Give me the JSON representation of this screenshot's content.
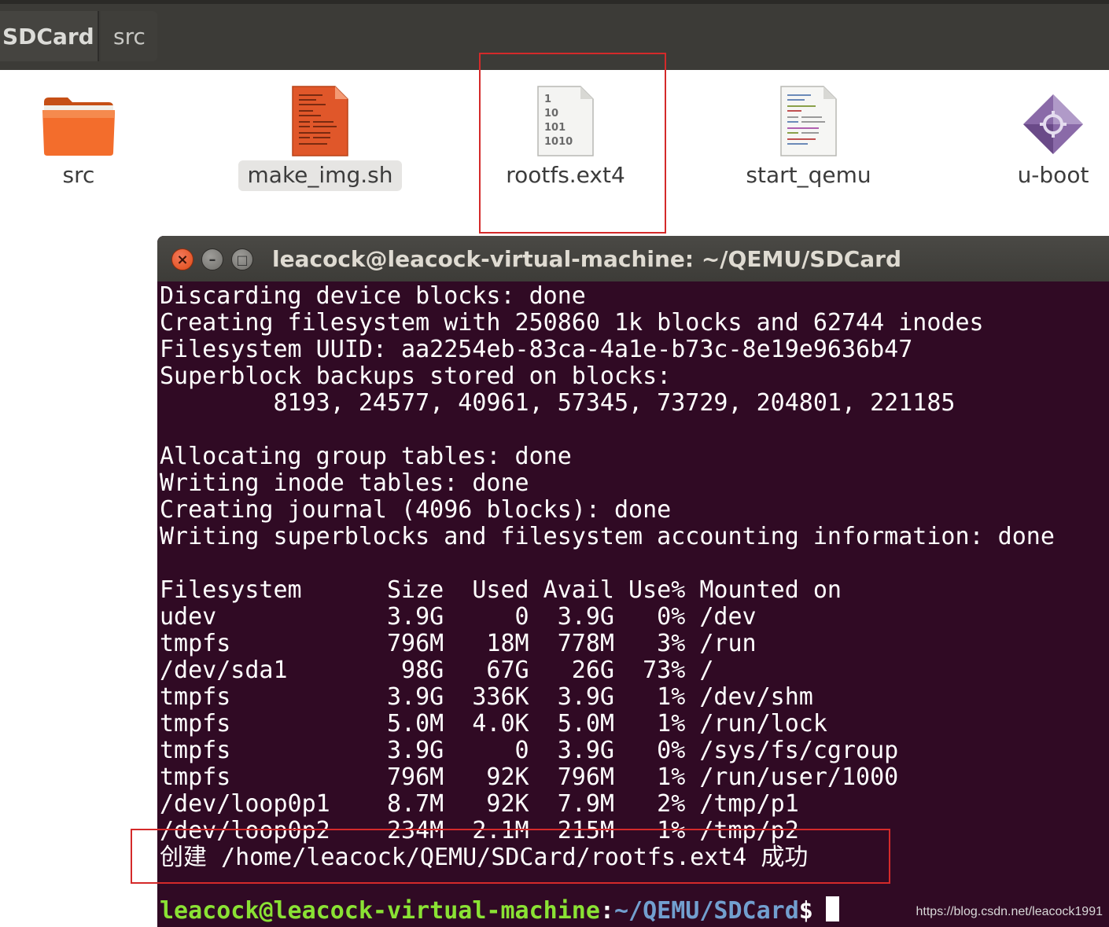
{
  "path_bar": {
    "crumbs": [
      "SDCard",
      "src"
    ]
  },
  "files": [
    {
      "name": "src",
      "icon": "folder-icon",
      "selected": false
    },
    {
      "name": "make_img.sh",
      "icon": "shell-script-icon",
      "selected": true
    },
    {
      "name": "rootfs.ext4",
      "icon": "binary-file-icon",
      "selected": false,
      "icon_text": [
        "1",
        "10",
        "101",
        "1010"
      ]
    },
    {
      "name": "start_qemu",
      "icon": "text-script-icon",
      "selected": false
    },
    {
      "name": "u-boot",
      "icon": "executable-icon",
      "selected": false
    }
  ],
  "terminal": {
    "title": "leacock@leacock-virtual-machine: ~/QEMU/SDCard",
    "buttons": {
      "close": "×",
      "minimize": "–",
      "maximize": "□"
    },
    "lines": [
      "Discarding device blocks: done",
      "Creating filesystem with 250860 1k blocks and 62744 inodes",
      "Filesystem UUID: aa2254eb-83ca-4a1e-b73c-8e19e9636b47",
      "Superblock backups stored on blocks:",
      "        8193, 24577, 40961, 57345, 73729, 204801, 221185",
      "",
      "Allocating group tables: done",
      "Writing inode tables: done",
      "Creating journal (4096 blocks): done",
      "Writing superblocks and filesystem accounting information: done",
      "",
      "Filesystem      Size  Used Avail Use% Mounted on",
      "udev            3.9G     0  3.9G   0% /dev",
      "tmpfs           796M   18M  778M   3% /run",
      "/dev/sda1        98G   67G   26G  73% /",
      "tmpfs           3.9G  336K  3.9G   1% /dev/shm",
      "tmpfs           5.0M  4.0K  5.0M   1% /run/lock",
      "tmpfs           3.9G     0  3.9G   0% /sys/fs/cgroup",
      "tmpfs           796M   92K  796M   1% /run/user/1000",
      "/dev/loop0p1    8.7M   92K  7.9M   2% /tmp/p1",
      "/dev/loop0p2    234M  2.1M  215M   1% /tmp/p2",
      "创建 /home/leacock/QEMU/SDCard/rootfs.ext4 成功"
    ],
    "prompt": {
      "user_host": "leacock@leacock-virtual-machine",
      "colon": ":",
      "path": "~/QEMU/SDCard",
      "symbol": "$"
    },
    "colors": {
      "background": "#300a24",
      "prompt_user": "#8ae234",
      "prompt_path": "#729fcf"
    }
  },
  "watermark": "https://blog.csdn.net/leacock1991"
}
